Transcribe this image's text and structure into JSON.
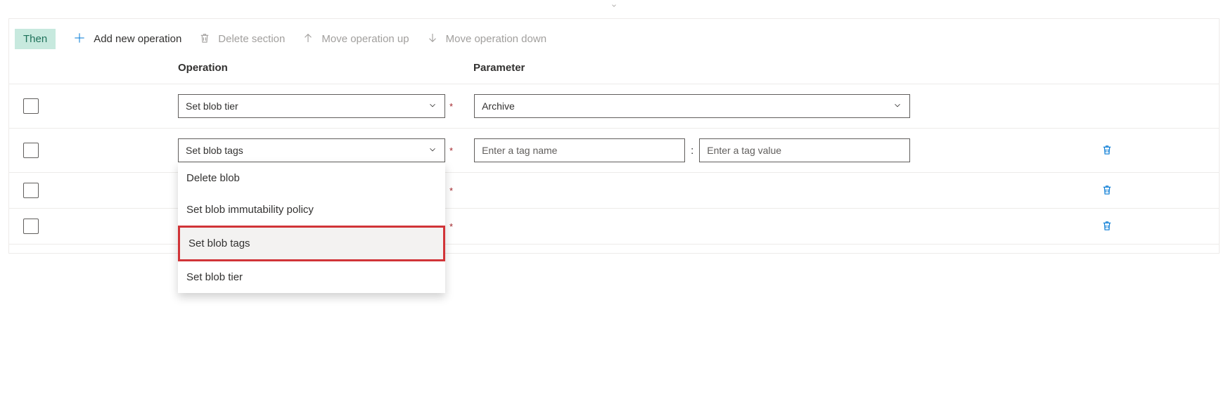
{
  "badge": "Then",
  "toolbar": {
    "add": "Add new operation",
    "delete_section": "Delete section",
    "move_up": "Move operation up",
    "move_down": "Move operation down"
  },
  "headers": {
    "operation": "Operation",
    "parameter": "Parameter"
  },
  "required_mark": "*",
  "tag_separator": ":",
  "rows": [
    {
      "operation": "Set blob tier",
      "parameter": "Archive"
    },
    {
      "operation": "Set blob tags",
      "tag_name_placeholder": "Enter a tag name",
      "tag_value_placeholder": "Enter a tag value"
    },
    {
      "operation": ""
    },
    {
      "operation": ""
    }
  ],
  "dropdown": {
    "options": [
      "Delete blob",
      "Set blob immutability policy",
      "Set blob tags",
      "Set blob tier"
    ],
    "highlighted_index": 2
  }
}
